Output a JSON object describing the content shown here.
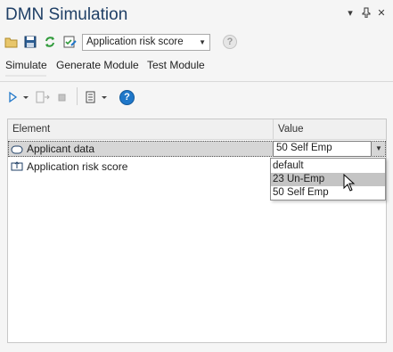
{
  "window": {
    "title": "DMN Simulation"
  },
  "toolbar": {
    "selected_model": "Application risk score",
    "help_label": "?"
  },
  "tabs": [
    {
      "label": "Simulate"
    },
    {
      "label": "Generate Module"
    },
    {
      "label": "Test Module"
    }
  ],
  "sim_toolbar": {
    "help_label": "?"
  },
  "grid": {
    "headers": {
      "element": "Element",
      "value": "Value"
    },
    "rows": [
      {
        "element": "Applicant data",
        "value": "50 Self Emp"
      },
      {
        "element": "Application risk score",
        "value": ""
      }
    ]
  },
  "dropdown": {
    "options": [
      {
        "label": "default"
      },
      {
        "label": "23 Un-Emp"
      },
      {
        "label": "50 Self Emp"
      }
    ],
    "highlighted_index": 1
  },
  "colors": {
    "title": "#1f3f66",
    "help_blue": "#1f77c9",
    "selection": "#d6d6d6",
    "highlight": "#c4c4c4"
  },
  "icons": [
    "open-folder-icon",
    "save-icon",
    "refresh-icon",
    "edit-check-icon",
    "help-icon",
    "run-icon",
    "step-icon",
    "stop-icon",
    "document-icon",
    "pin-icon",
    "close-icon",
    "dropdown-icon",
    "input-data-icon",
    "decision-icon",
    "mouse-cursor"
  ]
}
